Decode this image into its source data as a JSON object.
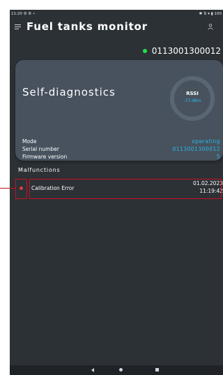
{
  "status_bar": {
    "time": "11:20",
    "left_icons": "⚙ ⚙ •",
    "right_icons": "✱ ⇅ ▾ ▮ 100"
  },
  "app_bar": {
    "title": "Fuel tanks monitor"
  },
  "device": {
    "id": "0113001300012",
    "status_color": "#22e04a"
  },
  "diagnostics": {
    "title": "Self-diagnostics",
    "rssi": {
      "label": "RSSI",
      "value": "-73 dBm"
    },
    "fields": [
      {
        "key": "Mode",
        "value": "operating"
      },
      {
        "key": "Serial number",
        "value": "0113001300012"
      },
      {
        "key": "Firmware version",
        "value": "5"
      }
    ]
  },
  "malfunctions": {
    "title": "Malfunctions",
    "items": [
      {
        "name": "Calibration Error",
        "date": "01.02.2023",
        "time": "11:19:42",
        "indicator_color": "#e53935"
      }
    ]
  },
  "colors": {
    "background": "#2c3136",
    "card": "#47525e",
    "accent": "#29b8e8",
    "highlight": "#c8101e"
  }
}
